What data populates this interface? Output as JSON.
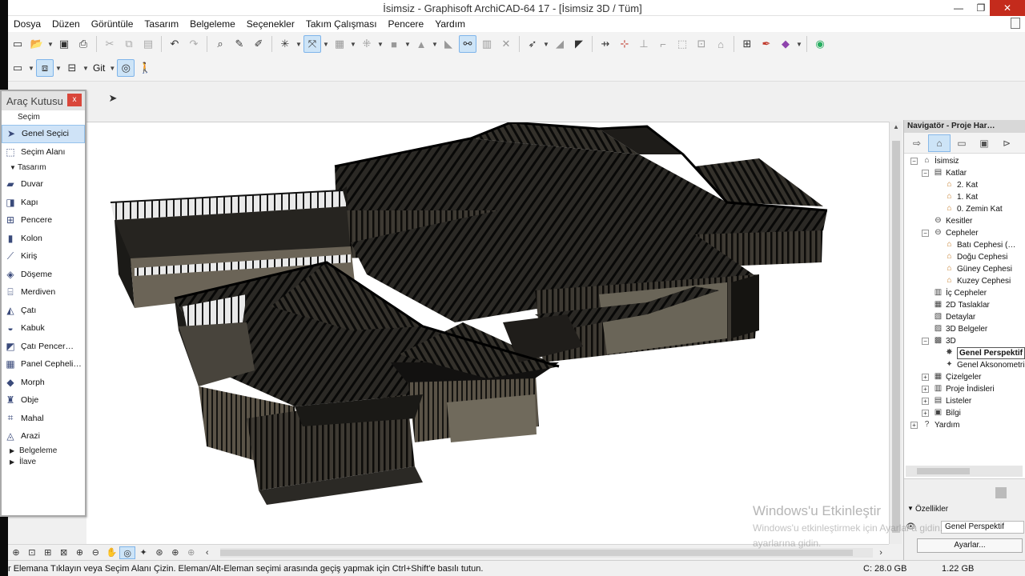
{
  "window": {
    "title": "İsimsiz - Graphisoft ArchiCAD-64 17 - [İsimsiz 3D / Tüm]",
    "minimize": "—",
    "maximize": "❐",
    "close": "✕"
  },
  "menu": [
    "Dosya",
    "Düzen",
    "Görüntüle",
    "Tasarım",
    "Belgeleme",
    "Seçenekler",
    "Takım Çalışması",
    "Pencere",
    "Yardım"
  ],
  "toolbar2": {
    "git_label": "Git"
  },
  "toolbox": {
    "title": "Araç Kutusu",
    "close": "x",
    "sections": {
      "secim": "Seçim",
      "tasarim": "Tasarım",
      "belgeleme": "Belgeleme",
      "ilave": "İlave"
    },
    "selection_items": [
      {
        "label": "Genel Seçici",
        "icon": "arrow-cursor-icon"
      },
      {
        "label": "Seçim Alanı",
        "icon": "marquee-icon"
      }
    ],
    "design_items": [
      {
        "label": "Duvar",
        "icon": "wall-icon"
      },
      {
        "label": "Kapı",
        "icon": "door-icon"
      },
      {
        "label": "Pencere",
        "icon": "window-icon"
      },
      {
        "label": "Kolon",
        "icon": "column-icon"
      },
      {
        "label": "Kiriş",
        "icon": "beam-icon"
      },
      {
        "label": "Döşeme",
        "icon": "slab-icon"
      },
      {
        "label": "Merdiven",
        "icon": "stair-icon"
      },
      {
        "label": "Çatı",
        "icon": "roof-icon"
      },
      {
        "label": "Kabuk",
        "icon": "shell-icon"
      },
      {
        "label": "Çatı Pencer…",
        "icon": "skylight-icon"
      },
      {
        "label": "Panel Cepheli…",
        "icon": "curtain-wall-icon"
      },
      {
        "label": "Morph",
        "icon": "morph-icon"
      },
      {
        "label": "Obje",
        "icon": "object-icon"
      },
      {
        "label": "Mahal",
        "icon": "zone-icon"
      },
      {
        "label": "Arazi",
        "icon": "mesh-icon"
      }
    ]
  },
  "navigator": {
    "header": "Navigatör - Proje Har…",
    "tree": [
      {
        "label": "İsimsiz",
        "level": 0,
        "toggle": "−"
      },
      {
        "label": "Katlar",
        "level": 1,
        "toggle": "−"
      },
      {
        "label": "2. Kat",
        "level": 2
      },
      {
        "label": "1. Kat",
        "level": 2
      },
      {
        "label": "0. Zemin Kat",
        "level": 2
      },
      {
        "label": "Kesitler",
        "level": 1
      },
      {
        "label": "Cepheler",
        "level": 1,
        "toggle": "−"
      },
      {
        "label": "Batı Cephesi (…",
        "level": 2
      },
      {
        "label": "Doğu Cephesi",
        "level": 2
      },
      {
        "label": "Güney Cephesi",
        "level": 2
      },
      {
        "label": "Kuzey Cephesi",
        "level": 2
      },
      {
        "label": "İç Cepheler",
        "level": 1
      },
      {
        "label": "2D Taslaklar",
        "level": 1
      },
      {
        "label": "Detaylar",
        "level": 1
      },
      {
        "label": "3D Belgeler",
        "level": 1
      },
      {
        "label": "3D",
        "level": 1,
        "toggle": "−"
      },
      {
        "label": "Genel Perspektif",
        "level": 2,
        "selected": true
      },
      {
        "label": "Genel Aksonometri",
        "level": 2
      },
      {
        "label": "Çizelgeler",
        "level": 1,
        "toggle": "+"
      },
      {
        "label": "Proje İndisleri",
        "level": 1,
        "toggle": "+"
      },
      {
        "label": "Listeler",
        "level": 1,
        "toggle": "+"
      },
      {
        "label": "Bilgi",
        "level": 1,
        "toggle": "+"
      },
      {
        "label": "Yardım",
        "level": 0,
        "toggle": "+"
      }
    ]
  },
  "properties": {
    "title": "Özellikler",
    "view_name": "Genel Perspektif",
    "settings_button": "Ayarlar..."
  },
  "status": {
    "hint": "r Elemana Tıklayın veya Seçim Alanı Çizin.  Eleman/Alt-Eleman seçimi arasında geçiş yapmak için Ctrl+Shift'e basılı tutun.",
    "disk_c": "C: 28.0 GB",
    "memory": "1.22 GB"
  },
  "watermark": {
    "line1": "Windows'u Etkinleştir",
    "line2": "Windows'u etkinleştirmek için Ayarlar'a gidin.",
    "line3": "ayarlarına gidin."
  }
}
